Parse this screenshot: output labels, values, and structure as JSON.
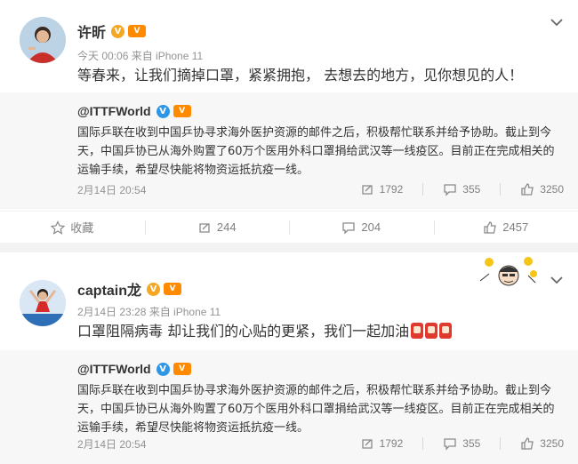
{
  "colors": {
    "verified_gold": "#f5a623",
    "verified_blue": "#2f96e6",
    "vip_orange": "#ff8a00",
    "text_main": "#333333",
    "text_meta": "#939393",
    "repost_bg": "#f7f7f7"
  },
  "posts": [
    {
      "username": "许昕",
      "verified_icon": "gold-verified-v-icon",
      "vip_icon": "vip-badge-icon",
      "meta": "今天 00:06 来自 iPhone 11",
      "text": "等春来，让我们摘掉口罩，紧紧拥抱， 去想去的地方，见你想见的人！",
      "repost": {
        "author": "@ITTFWorld",
        "text": "国际乒联在收到中国乒协寻求海外医护资源的邮件之后，积极帮忙联系并给予协助。截止到今天，中国乒协已从海外购置了60万个医用外科口罩捐给武汉等一线疫区。目前正在完成相关的运输手续，希望尽快能将物资运抵抗疫一线。",
        "date": "2月14日 20:54",
        "stats": {
          "reposts": "1792",
          "comments": "355",
          "likes": "3250"
        }
      },
      "actions": {
        "favorite": "收藏",
        "repost": "244",
        "comment": "204",
        "like": "2457"
      }
    },
    {
      "username": "captain龙",
      "verified_icon": "gold-verified-v-icon",
      "vip_icon": "vip-badge-icon",
      "meta": "2月14日 23:28 来自 iPhone 11",
      "text": "口罩阻隔病毒 却让我们的心贴的更紧，我们一起加油",
      "text_emojis": [
        "mask-emoji-icon",
        "mask-emoji-icon",
        "mask-emoji-icon"
      ],
      "repost": {
        "author": "@ITTFWorld",
        "text": "国际乒联在收到中国乒协寻求海外医护资源的邮件之后，积极帮忙联系并给予协助。截止到今天，中国乒协已从海外购置了60万个医用外科口罩捐给武汉等一线疫区。目前正在完成相关的运输手续，希望尽快能将物资运抵抗疫一线。",
        "date": "2月14日 20:54",
        "stats": {
          "reposts": "1792",
          "comments": "355",
          "likes": "3250"
        }
      }
    }
  ]
}
